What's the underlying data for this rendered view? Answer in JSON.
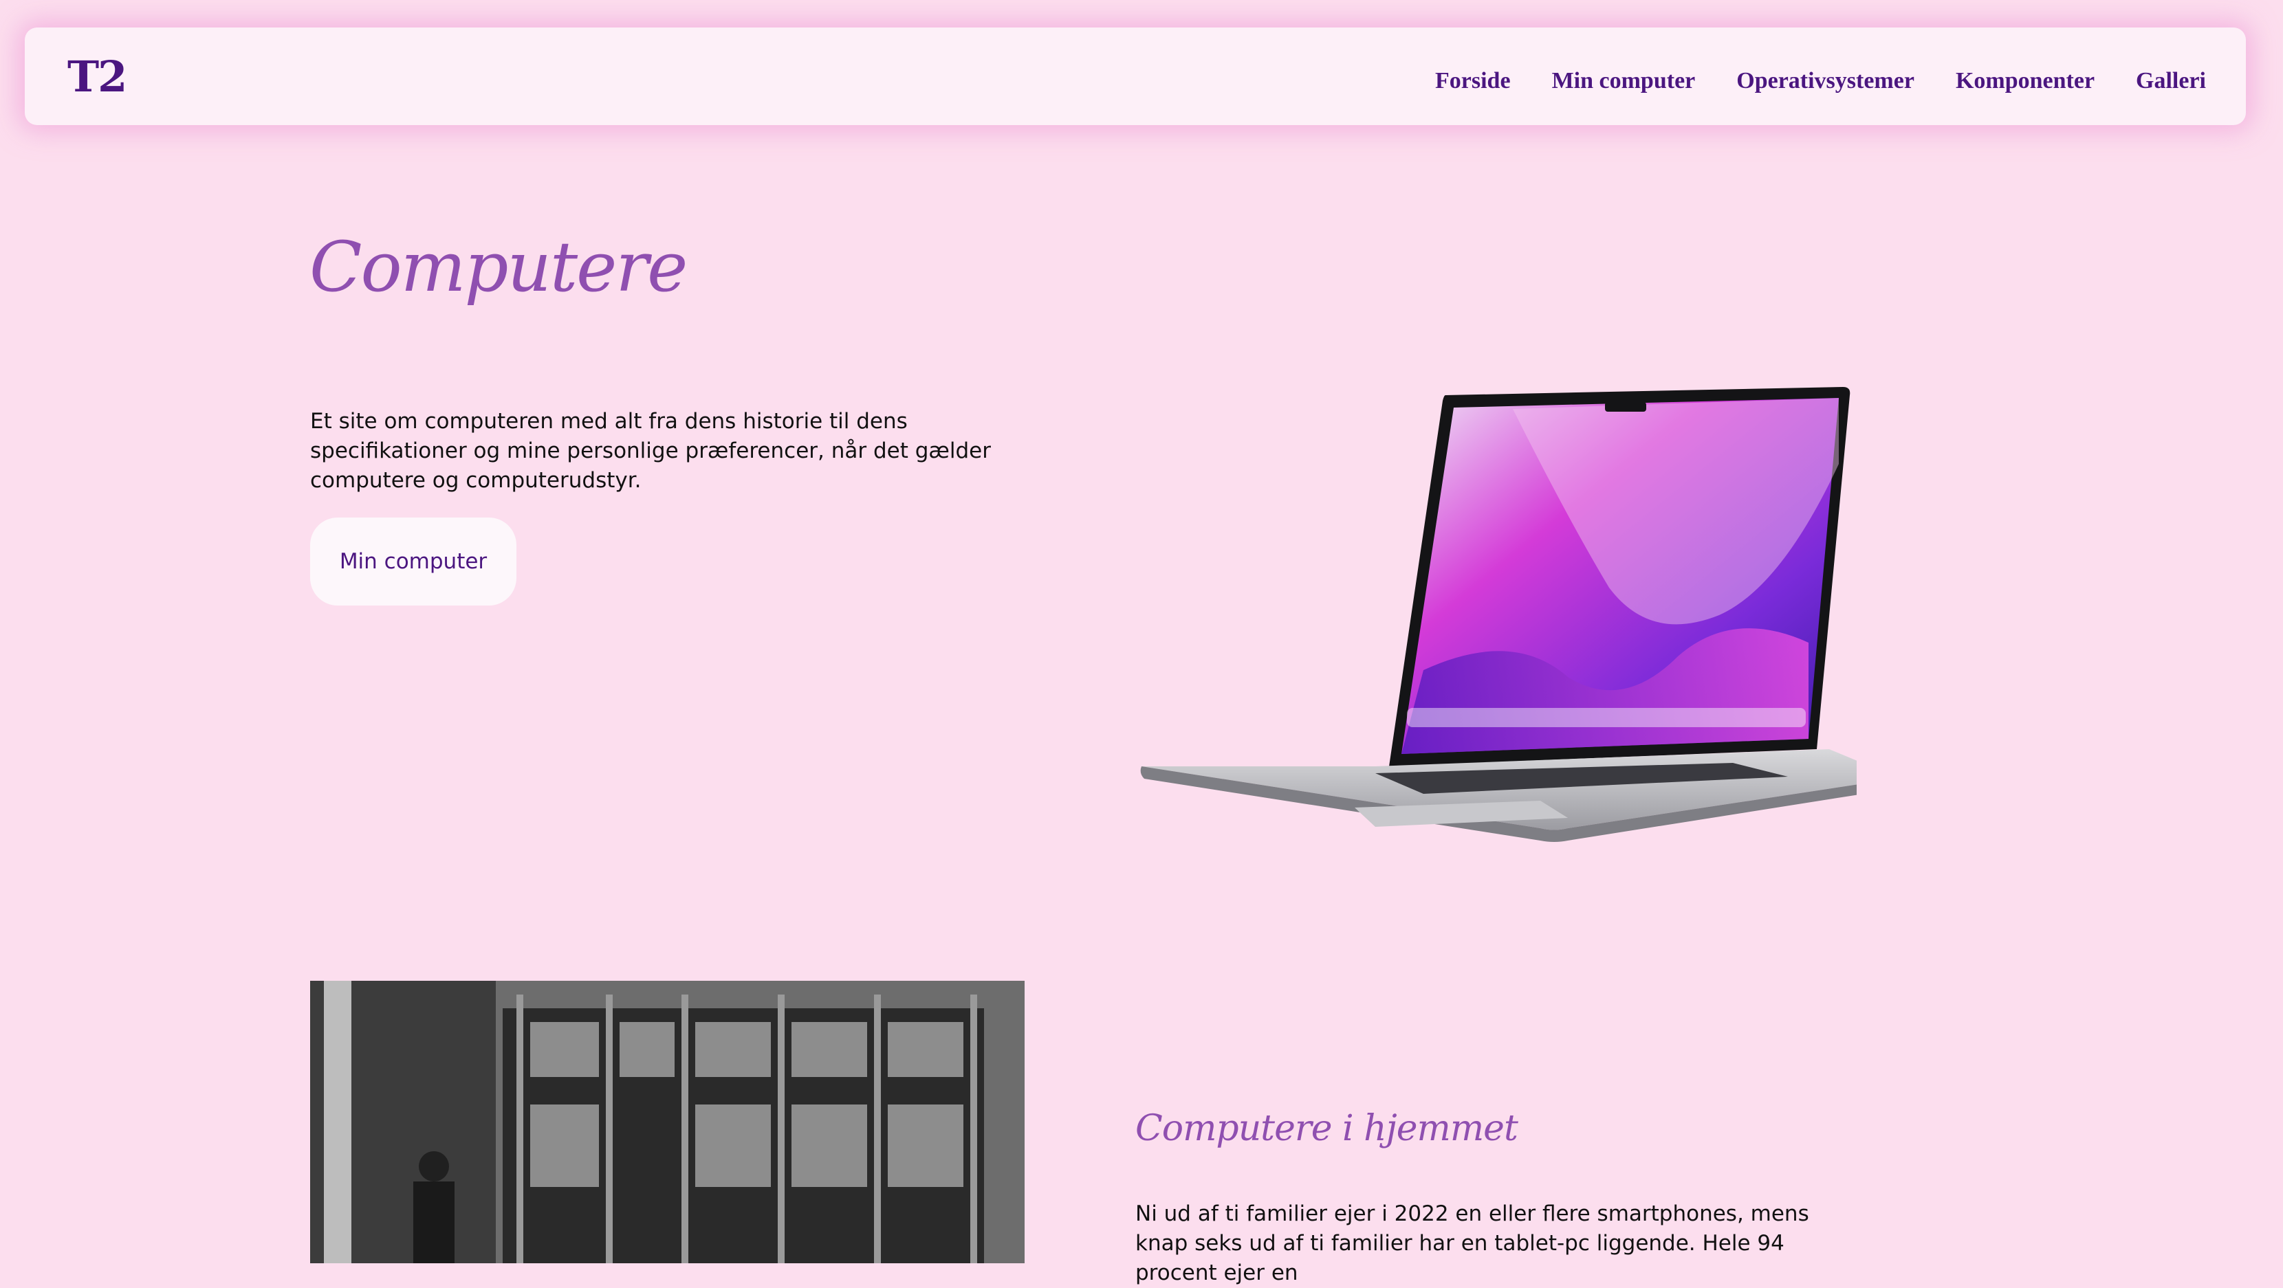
{
  "nav": {
    "logo": "T2",
    "links": [
      "Forside",
      "Min computer",
      "Operativsystemer",
      "Komponenter",
      "Galleri"
    ]
  },
  "hero": {
    "title": "Computere",
    "description": "Et site om computeren med alt fra dens historie til dens specifikationer og mine personlige præferencer, når det gælder computere og computerudstyr.",
    "button_label": "Min computer"
  },
  "section2": {
    "title": "Computere i hjemmet",
    "text": "Ni ud af ti familier ejer i 2022 en eller flere smartphones, mens knap seks ud af ti familier har en tablet-pc liggende. Hele 94 procent ejer en"
  },
  "colors": {
    "background": "#fcdeee",
    "nav_background": "#fdf0f8",
    "accent_dark": "#4b1680",
    "accent_heading": "#8f4fb0"
  }
}
